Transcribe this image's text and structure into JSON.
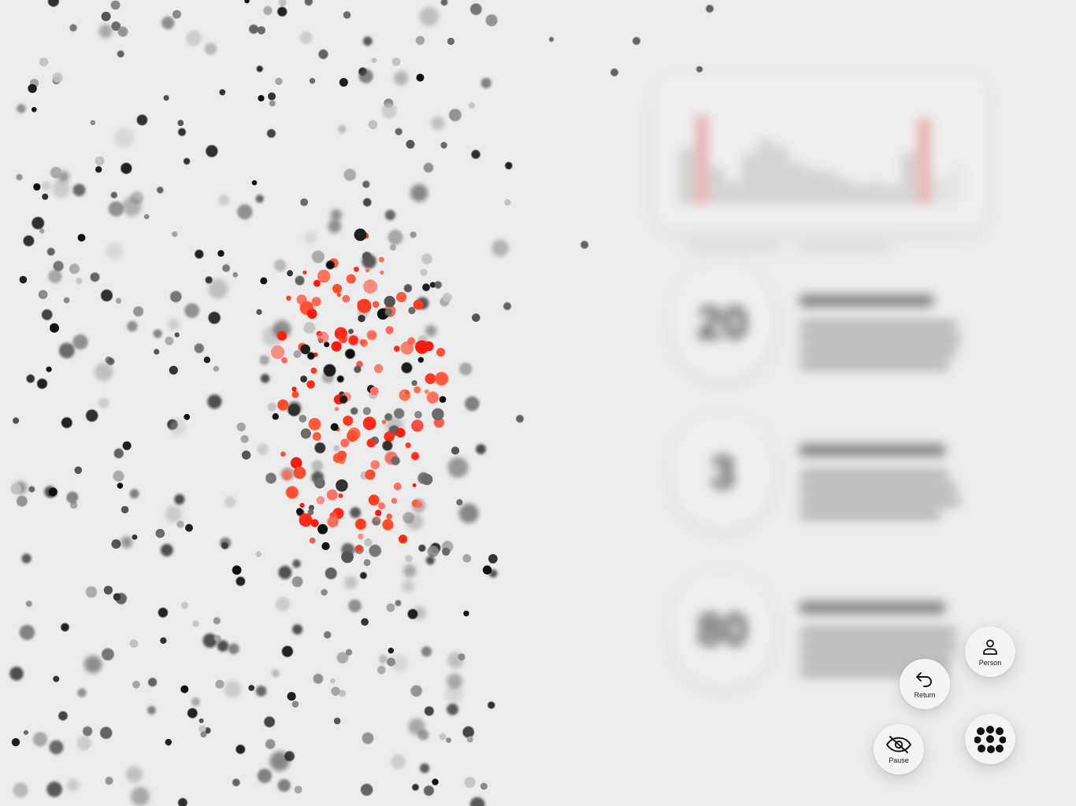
{
  "controls": {
    "person_label": "Person",
    "return_label": "Return",
    "pause_label": "Pause"
  },
  "icons": {
    "person": "person-icon",
    "return": "return-arrow-icon",
    "pause": "eye-slash-icon",
    "menu": "dots-cluster-icon"
  },
  "colors": {
    "background": "#ececec",
    "accent_red": "#ff3b1f",
    "particle_dark": "#1a1a1a",
    "button_bg": "#f4f4f4"
  }
}
